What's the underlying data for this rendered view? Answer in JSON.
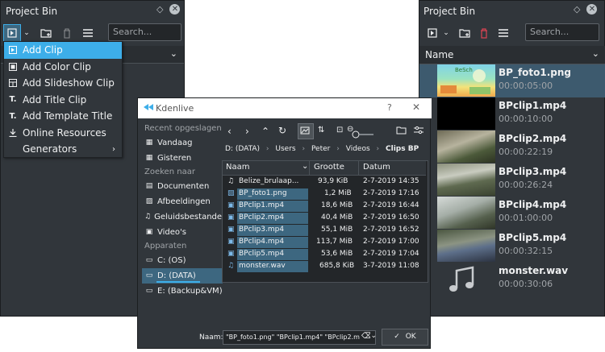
{
  "left_panel": {
    "title": "Project Bin",
    "search_placeholder": "Search...",
    "menu": [
      {
        "label": "Add Clip",
        "icon": "add-clip-icon"
      },
      {
        "label": "Add Color Clip",
        "icon": "color-clip-icon"
      },
      {
        "label": "Add Slideshow Clip",
        "icon": "slideshow-icon"
      },
      {
        "label": "Add Title Clip",
        "icon": "title-clip-icon"
      },
      {
        "label": "Add Template Title",
        "icon": "template-title-icon"
      },
      {
        "label": "Online Resources",
        "icon": "download-icon"
      },
      {
        "label": "Generators",
        "icon": ""
      }
    ]
  },
  "right_panel": {
    "title": "Project Bin",
    "search_placeholder": "Search...",
    "column_header": "Name",
    "clips": [
      {
        "name": "BP_foto1.png",
        "duration": "00:00:05:00"
      },
      {
        "name": "BPclip1.mp4",
        "duration": "00:00:10:00"
      },
      {
        "name": "BPclip2.mp4",
        "duration": "00:00:22:19"
      },
      {
        "name": "BPclip3.mp4",
        "duration": "00:00:26:24"
      },
      {
        "name": "BPclip4.mp4",
        "duration": "00:01:00:00"
      },
      {
        "name": "BPclip5.mp4",
        "duration": "00:00:32:15"
      },
      {
        "name": "monster.wav",
        "duration": "00:00:30:06"
      }
    ]
  },
  "dialog": {
    "title": "Kdenlive",
    "help": "?",
    "close": "✕",
    "places": {
      "recent_header": "Recent opgeslagen",
      "recent": [
        "Vandaag",
        "Gisteren"
      ],
      "search_header": "Zoeken naar",
      "search": [
        "Documenten",
        "Afbeeldingen",
        "Geluidsbestanden",
        "Video's"
      ],
      "devices_header": "Apparaten",
      "devices": [
        "C: (OS)",
        "D: (DATA)",
        "E: (Backup&VM)"
      ]
    },
    "breadcrumb": [
      "D: (DATA)",
      "Users",
      "Peter",
      "Videos",
      "Clips BP"
    ],
    "columns": [
      "Naam",
      "Grootte",
      "Datum"
    ],
    "files": [
      {
        "name": "Belize_brulaap...",
        "size": "93,9 KiB",
        "date": "2-7-2019 14:35"
      },
      {
        "name": "BP_foto1.png",
        "size": "1,2 MiB",
        "date": "2-7-2019 17:16"
      },
      {
        "name": "BPclip1.mp4",
        "size": "18,6 MiB",
        "date": "2-7-2019 16:44"
      },
      {
        "name": "BPclip2.mp4",
        "size": "40,4 MiB",
        "date": "2-7-2019 16:50"
      },
      {
        "name": "BPclip3.mp4",
        "size": "55,1 MiB",
        "date": "2-7-2019 16:52"
      },
      {
        "name": "BPclip4.mp4",
        "size": "113,7 MiB",
        "date": "2-7-2019 17:00"
      },
      {
        "name": "BPclip5.mp4",
        "size": "53,6 MiB",
        "date": "2-7-2019 17:04"
      },
      {
        "name": "monster.wav",
        "size": "685,8 KiB",
        "date": "3-7-2019 11:08"
      }
    ],
    "filename_label": "Naam:",
    "filename_value": "\"BP_foto1.png\" \"BPclip1.mp4\" \"BPclip2.mp4\"",
    "ok_label": "OK"
  },
  "colors": {
    "panel_bg": "#31363b",
    "accent": "#3daee9",
    "selection": "#3d6780"
  }
}
